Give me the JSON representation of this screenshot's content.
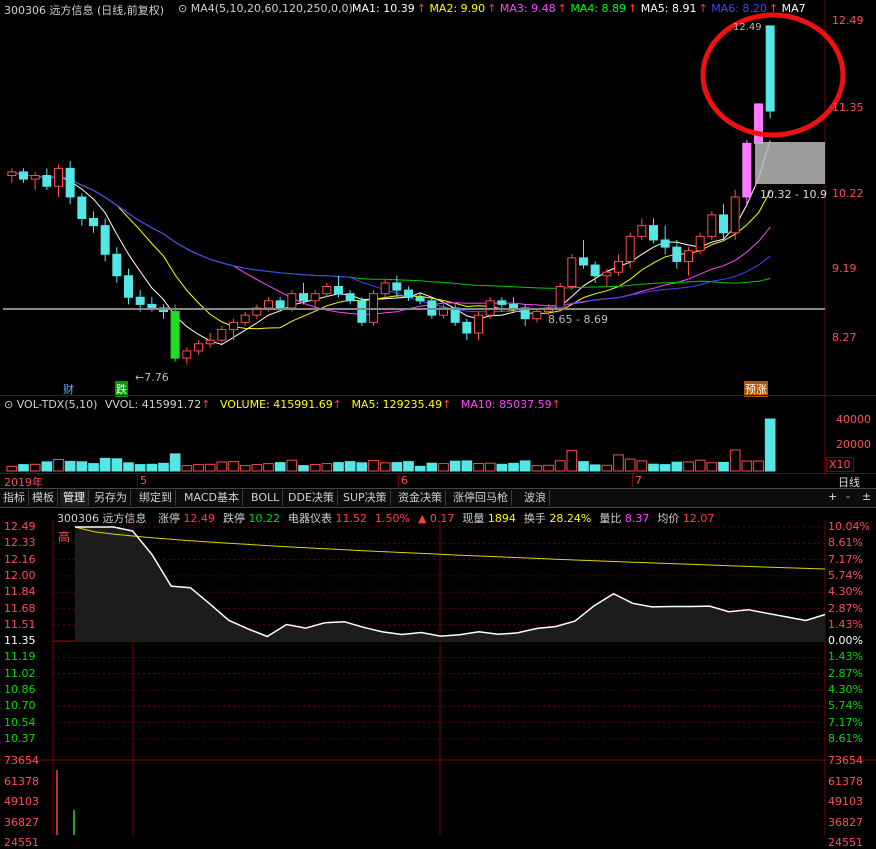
{
  "header": {
    "code_name": "300306 远方信息 (日线,前复权)",
    "ma_indicator": "MA4(5,10,20,60,120,250,0,0)",
    "ma_values": [
      {
        "label": "MA1: 10.39",
        "color": "#ffffff"
      },
      {
        "label": "MA2: 9.90",
        "color": "#ffff00"
      },
      {
        "label": "MA3: 9.48",
        "color": "#ff44ff"
      },
      {
        "label": "MA4: 8.89",
        "color": "#00ff00"
      },
      {
        "label": "MA5: 8.91",
        "color": "#ffffff"
      },
      {
        "label": "MA6: 8.20",
        "color": "#4444ff"
      },
      {
        "label": "MA7",
        "color": "#ffffff"
      }
    ]
  },
  "kline": {
    "y_ticks": [
      "12.49",
      "11.35",
      "10.22",
      "9.19",
      "8.27"
    ],
    "annotations": {
      "high": "12.49",
      "range": "10.32 - 10.9",
      "mid": "8.65 - 8.69",
      "low": "7.76"
    },
    "markers": {
      "cai": "财",
      "die": "跌",
      "yuzhang": "预涨"
    }
  },
  "volume": {
    "title": "VOL-TDX(5,10)",
    "vvol": "VVOL: 415991.72",
    "volume": "VOLUME: 415991.69",
    "ma5": "MA5: 129235.49",
    "ma10": "MA10: 85037.59",
    "y_ticks": [
      "40000",
      "20000"
    ],
    "unit": "X10"
  },
  "axis": {
    "year": "2019年",
    "months": [
      "5",
      "6",
      "7"
    ],
    "period": "日线",
    "btn_plus": "+",
    "btn_minus": "-",
    "btn_pm": "±"
  },
  "tabs": [
    "指标",
    "模板",
    "管理",
    "另存为",
    "绑定到",
    "MACD基本",
    "BOLL",
    "DDE决策",
    "SUP决策",
    "资金决策",
    "涨停回马枪",
    "波浪"
  ],
  "tabs_active": 2,
  "intraday": {
    "code": "300306 远方信息",
    "stats": [
      {
        "k": "涨停",
        "v": "12.49",
        "vc": "#ff4040"
      },
      {
        "k": "跌停",
        "v": "10.22",
        "vc": "#00dd00"
      },
      {
        "k": "电器仪表",
        "v": "11.52",
        "vc": "#ff4040"
      },
      {
        "k": "",
        "v": "1.50%",
        "vc": "#ff4040"
      },
      {
        "k": "▲",
        "v": "0.17",
        "vc": "#ff4040"
      },
      {
        "k": "现量",
        "v": "1894",
        "vc": "#ffff00"
      },
      {
        "k": "换手",
        "v": "28.24%",
        "vc": "#ffff00"
      },
      {
        "k": "量比",
        "v": "8.37",
        "vc": "#ff44ff"
      },
      {
        "k": "均价",
        "v": "12.07",
        "vc": "#ff4040"
      }
    ],
    "high_label": "高",
    "left_prices": [
      "12.49",
      "12.33",
      "12.16",
      "12.00",
      "11.84",
      "11.68",
      "11.51",
      "11.35",
      "11.19",
      "11.02",
      "10.86",
      "10.70",
      "10.54",
      "10.37"
    ],
    "right_pcts": [
      "10.04%",
      "8.61%",
      "7.17%",
      "5.74%",
      "4.30%",
      "2.87%",
      "1.43%",
      "0.00%",
      "1.43%",
      "2.87%",
      "4.30%",
      "5.74%",
      "7.17%",
      "8.61%"
    ],
    "vol_ticks": [
      "73654",
      "61378",
      "49103",
      "36827",
      "24551"
    ]
  },
  "colors": {
    "up": "#ff4c4c",
    "down": "#55e6e6",
    "limit": "#ff7aff",
    "grid": "#7a0000"
  },
  "chart_data": {
    "type": "candlestick",
    "title": "300306 远方信息 (日线,前复权)",
    "ylim": [
      7.6,
      12.6
    ],
    "candles": [
      [
        10.4,
        10.5,
        10.3,
        10.45
      ],
      [
        10.45,
        10.5,
        10.3,
        10.35
      ],
      [
        10.35,
        10.45,
        10.2,
        10.4
      ],
      [
        10.4,
        10.5,
        10.2,
        10.25
      ],
      [
        10.25,
        10.55,
        10.1,
        10.5
      ],
      [
        10.5,
        10.6,
        10.0,
        10.1
      ],
      [
        10.1,
        10.15,
        9.7,
        9.8
      ],
      [
        9.8,
        9.9,
        9.6,
        9.7
      ],
      [
        9.7,
        9.8,
        9.2,
        9.3
      ],
      [
        9.3,
        9.4,
        8.9,
        9.0
      ],
      [
        9.0,
        9.1,
        8.6,
        8.7
      ],
      [
        8.7,
        8.8,
        8.5,
        8.6
      ],
      [
        8.6,
        8.7,
        8.5,
        8.55
      ],
      [
        8.55,
        8.6,
        8.4,
        8.5
      ],
      [
        8.5,
        8.6,
        7.8,
        7.85
      ],
      [
        7.85,
        8.0,
        7.76,
        7.95
      ],
      [
        7.95,
        8.1,
        7.9,
        8.05
      ],
      [
        8.05,
        8.2,
        8.0,
        8.1
      ],
      [
        8.1,
        8.3,
        8.05,
        8.25
      ],
      [
        8.25,
        8.4,
        8.1,
        8.35
      ],
      [
        8.35,
        8.5,
        8.3,
        8.45
      ],
      [
        8.45,
        8.6,
        8.4,
        8.55
      ],
      [
        8.55,
        8.7,
        8.5,
        8.65
      ],
      [
        8.65,
        8.7,
        8.5,
        8.55
      ],
      [
        8.55,
        8.8,
        8.5,
        8.75
      ],
      [
        8.75,
        8.9,
        8.6,
        8.65
      ],
      [
        8.65,
        8.8,
        8.55,
        8.75
      ],
      [
        8.75,
        8.9,
        8.7,
        8.85
      ],
      [
        8.85,
        9.0,
        8.7,
        8.75
      ],
      [
        8.75,
        8.8,
        8.6,
        8.65
      ],
      [
        8.65,
        8.7,
        8.3,
        8.35
      ],
      [
        8.35,
        8.8,
        8.3,
        8.75
      ],
      [
        8.75,
        8.95,
        8.7,
        8.9
      ],
      [
        8.9,
        9.0,
        8.7,
        8.8
      ],
      [
        8.8,
        8.85,
        8.65,
        8.7
      ],
      [
        8.7,
        8.75,
        8.6,
        8.65
      ],
      [
        8.65,
        8.7,
        8.4,
        8.45
      ],
      [
        8.45,
        8.6,
        8.4,
        8.55
      ],
      [
        8.55,
        8.6,
        8.3,
        8.35
      ],
      [
        8.35,
        8.4,
        8.1,
        8.2
      ],
      [
        8.2,
        8.5,
        8.1,
        8.45
      ],
      [
        8.45,
        8.7,
        8.4,
        8.65
      ],
      [
        8.65,
        8.7,
        8.5,
        8.6
      ],
      [
        8.6,
        8.7,
        8.5,
        8.55
      ],
      [
        8.55,
        8.6,
        8.3,
        8.4
      ],
      [
        8.4,
        8.55,
        8.35,
        8.5
      ],
      [
        8.5,
        8.6,
        8.45,
        8.55
      ],
      [
        8.55,
        8.9,
        8.5,
        8.85
      ],
      [
        8.85,
        9.3,
        8.8,
        9.25
      ],
      [
        9.25,
        9.5,
        9.1,
        9.15
      ],
      [
        9.15,
        9.2,
        8.9,
        9.0
      ],
      [
        9.0,
        9.1,
        8.85,
        9.05
      ],
      [
        9.05,
        9.3,
        9.0,
        9.2
      ],
      [
        9.2,
        9.6,
        9.1,
        9.55
      ],
      [
        9.55,
        9.8,
        9.5,
        9.7
      ],
      [
        9.7,
        9.8,
        9.45,
        9.5
      ],
      [
        9.5,
        9.7,
        9.3,
        9.4
      ],
      [
        9.4,
        9.5,
        9.1,
        9.2
      ],
      [
        9.2,
        9.4,
        9.0,
        9.35
      ],
      [
        9.35,
        9.6,
        9.3,
        9.55
      ],
      [
        9.55,
        9.9,
        9.5,
        9.85
      ],
      [
        9.85,
        10.0,
        9.5,
        9.6
      ],
      [
        9.6,
        10.2,
        9.5,
        10.1
      ],
      [
        10.1,
        10.9,
        10.0,
        10.85
      ],
      [
        10.85,
        11.4,
        10.85,
        11.4
      ],
      [
        11.3,
        12.49,
        11.2,
        12.49
      ]
    ],
    "intraday_series": [
      12.49,
      12.49,
      12.49,
      12.45,
      12.2,
      11.9,
      11.9,
      11.7,
      11.55,
      11.48,
      11.42,
      11.5,
      11.48,
      11.55,
      11.52,
      11.48,
      11.45,
      11.44,
      11.42,
      11.4,
      11.43,
      11.42,
      11.41,
      11.44,
      11.5,
      11.48,
      11.55,
      11.72,
      11.8,
      11.72,
      11.7,
      11.72,
      11.68,
      11.7,
      11.66,
      11.64,
      11.62,
      11.6,
      11.58,
      11.6
    ]
  }
}
